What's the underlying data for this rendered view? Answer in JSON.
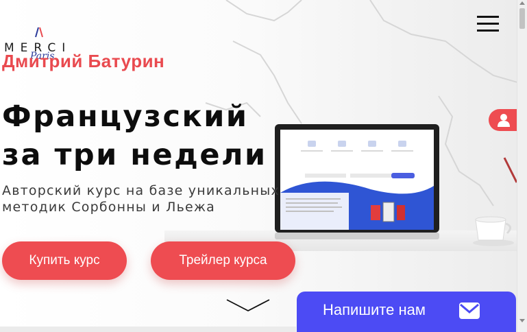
{
  "logo": {
    "text": "MERCI",
    "script_text": "Paris",
    "icon": "merci-paris-logo"
  },
  "author": "Дмитрий Батурин",
  "hero": {
    "title_line1": "Французский",
    "title_line2": "за три недели",
    "subtitle_line1": "Авторский курс на базе уникальных",
    "subtitle_line2": "методик Сорбонны и Льежа"
  },
  "buttons": {
    "buy": "Купить курс",
    "trailer": "Трейлер курса"
  },
  "contact": {
    "label": "Напишите нам",
    "icon": "mail-icon"
  },
  "icons": {
    "menu": "hamburger-menu-icon",
    "user": "user-icon",
    "scroll_down": "chevron-down-icon"
  },
  "colors": {
    "accent": "#ee4c51",
    "author": "#e94a4f",
    "contact": "#4c4bf4",
    "text": "#0d0d0d"
  }
}
